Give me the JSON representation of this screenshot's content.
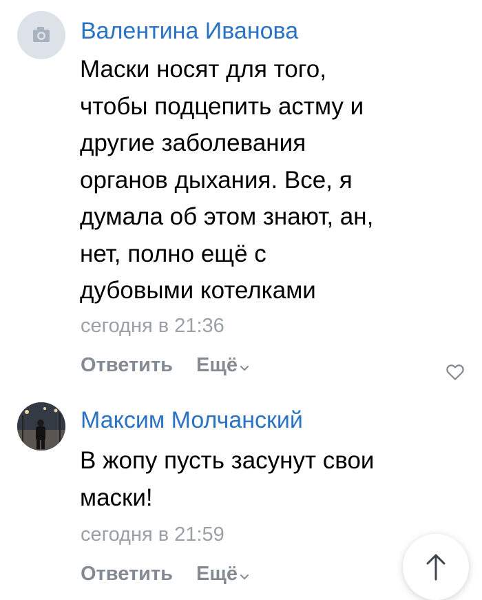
{
  "comments": [
    {
      "author": "Валентина Иванова",
      "avatar_icon": "camera-placeholder-icon",
      "text_lines": [
        "Маски носят для того,",
        "чтобы подцепить астму и",
        "другие заболевания",
        "органов дыхания. Все, я",
        "думала об этом знают, ан,",
        "нет, полно ещё с",
        "дубовыми котелками"
      ],
      "time": "сегодня в 21:36",
      "reply_label": "Ответить",
      "more_label": "Ещё",
      "like_icon": "heart-outline-icon"
    },
    {
      "author": "Максим Молчанский",
      "avatar_icon": "user-photo-avatar",
      "text_lines": [
        "В жопу пусть засунут свои",
        "маски!"
      ],
      "time": "сегодня в 21:59",
      "reply_label": "Ответить",
      "more_label": "Ещё"
    }
  ],
  "scroll_up_icon": "arrow-up-icon",
  "colors": {
    "author": "#2a73c4",
    "text": "#000000",
    "meta": "#9aa0a6",
    "actions": "#848a92",
    "background": "#ffffff"
  }
}
